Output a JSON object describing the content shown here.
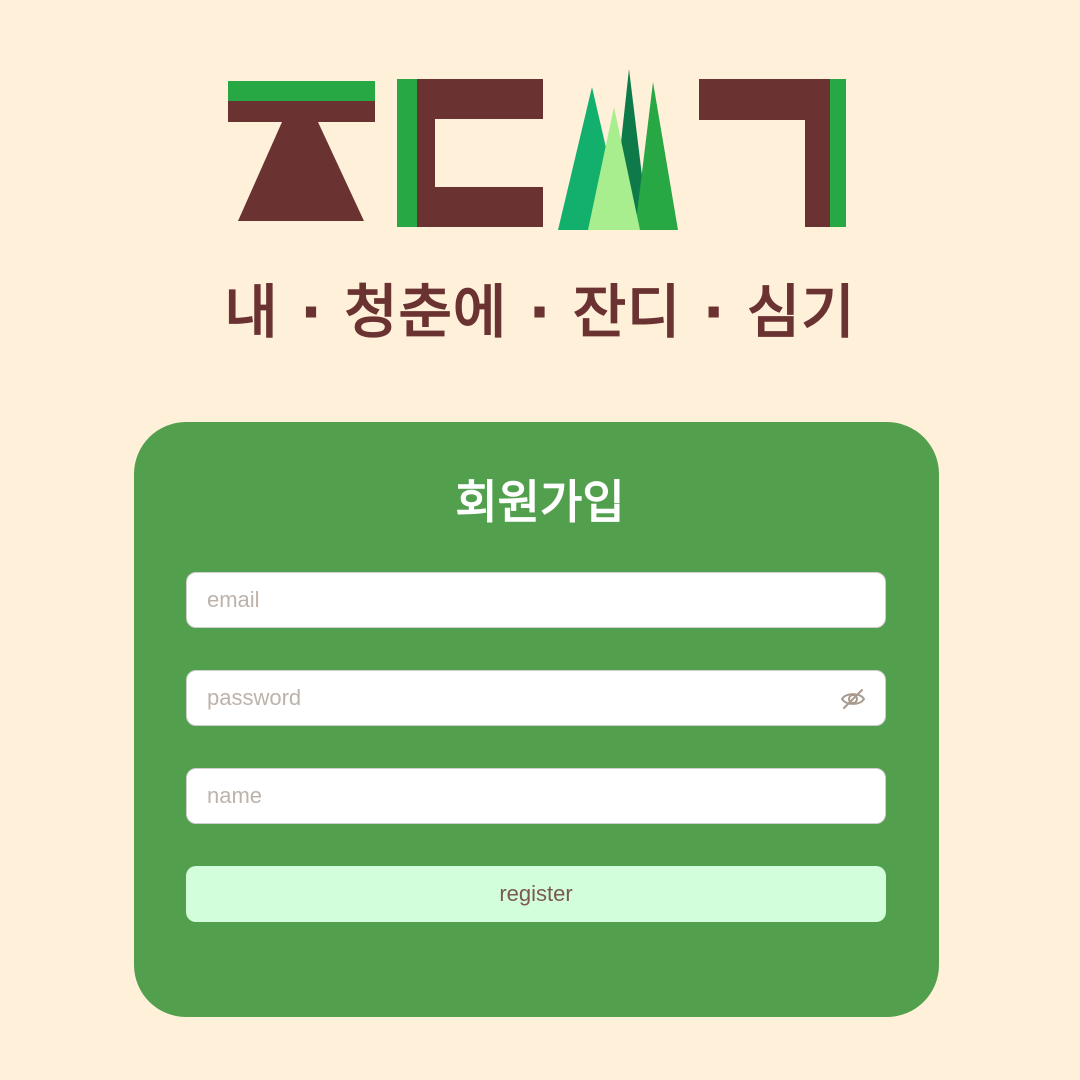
{
  "header": {
    "logo": "zandi-logo",
    "tagline": "내 · 청춘에 · 잔디 · 심기"
  },
  "form": {
    "title": "회원가입",
    "email": {
      "placeholder": "email",
      "value": ""
    },
    "password": {
      "placeholder": "password",
      "value": "",
      "toggle_icon": "eye-off-icon"
    },
    "name": {
      "placeholder": "name",
      "value": ""
    },
    "submit_label": "register"
  },
  "colors": {
    "background": "#FFF0DA",
    "brand_brown": "#6B3232",
    "card_green": "#52A04E",
    "button_mint": "#D3FEDB",
    "logo_green": "#28A745",
    "logo_dark_green": "#0E7A4A",
    "logo_light_green": "#A9EE8E"
  }
}
